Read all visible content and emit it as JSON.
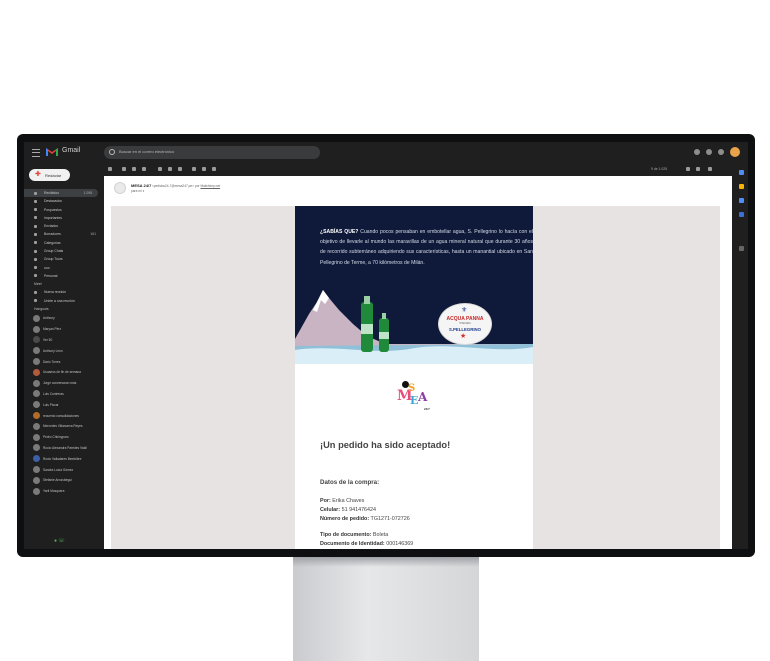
{
  "app": {
    "name": "Gmail"
  },
  "search": {
    "placeholder": "Buscar en el correo electrónico"
  },
  "compose": {
    "label": "Redactar"
  },
  "sidebar": {
    "items": [
      {
        "label": "Recibidos",
        "count": "1.098",
        "active": true
      },
      {
        "label": "Destacados"
      },
      {
        "label": "Pospuestos"
      },
      {
        "label": "Importantes"
      },
      {
        "label": "Enviados"
      },
      {
        "label": "Borradores",
        "count": "161"
      },
      {
        "label": "Categorías"
      },
      {
        "label": "Group Chats"
      },
      {
        "label": "Group Tours"
      },
      {
        "label": "ooo"
      },
      {
        "label": "Personal"
      }
    ],
    "more_label": "Meet",
    "meet_items": [
      {
        "label": "Nueva reunión"
      },
      {
        "label": "Unirte a una reunión"
      }
    ],
    "hangouts_label": "Hangouts",
    "people": [
      {
        "label": "Anthony"
      },
      {
        "label": "Maryan Pérz"
      },
      {
        "label": "Ver 50"
      },
      {
        "label": "Anthony Leon"
      },
      {
        "label": "Dario Torres"
      },
      {
        "label": "Usuarios de fin de semana"
      },
      {
        "label": "Jorge conversaron más"
      },
      {
        "label": "Luis Contreras"
      },
      {
        "label": "Luis Piccar"
      },
      {
        "label": "recuento consolidaciones"
      },
      {
        "label": "Mercedes Villanueva Reyes"
      },
      {
        "label": "Pedro Chirinyparo"
      },
      {
        "label": "Rocío Alexandra Paredes Valdi"
      },
      {
        "label": "Rocio Valladares Bembibre"
      },
      {
        "label": "Sandra Lucía Gómez"
      },
      {
        "label": "Stefanie Arrunátegui"
      },
      {
        "label": "Yarit Mosquera"
      }
    ]
  },
  "toolbar": {
    "page_info": "9 de 1.025"
  },
  "message": {
    "sender_name": "MESA 24/7",
    "sender_email": "<pedidos24-7@mesa247.pe> por",
    "sender_via": "Mailchimp.net",
    "to_line": "para mí"
  },
  "email": {
    "banner_lead": "¿SABÍAS QUE?",
    "banner_body": "Cuando pocos pensaban en embotellar agua, S. Pellegrino lo hacía con el objetivo de llevarle al mundo las maravillas de un agua mineral natural que durante 30 años de recorrido subterráneo adquiriendo sus características, hasta un manantial ubicado en San Pellegrino de Terme, a 70 kilómetros de Milán.",
    "panna_top": "ACQUA PANNA",
    "panna_sub": "TOSCANA",
    "panna_brand": "S.PELLEGRINO",
    "logo_num": "24/7",
    "headline": "¡Un pedido ha sido aceptado!",
    "section_title": "Datos de la compra:",
    "fields": [
      {
        "label": "Por:",
        "value": "Erika Chaves"
      },
      {
        "label": "Celular:",
        "value": "51 941476424"
      },
      {
        "label": "Número de pedido:",
        "value": "TG1271-072726"
      },
      {
        "label": "Tipo de documento:",
        "value": "Boleta"
      },
      {
        "label": "Documento de Identidad:",
        "value": "000146369"
      }
    ]
  },
  "colors": {
    "accent_red": "#e44134",
    "banner_bg": "#0f1a3a",
    "email_canvas": "#e8e3e3"
  }
}
